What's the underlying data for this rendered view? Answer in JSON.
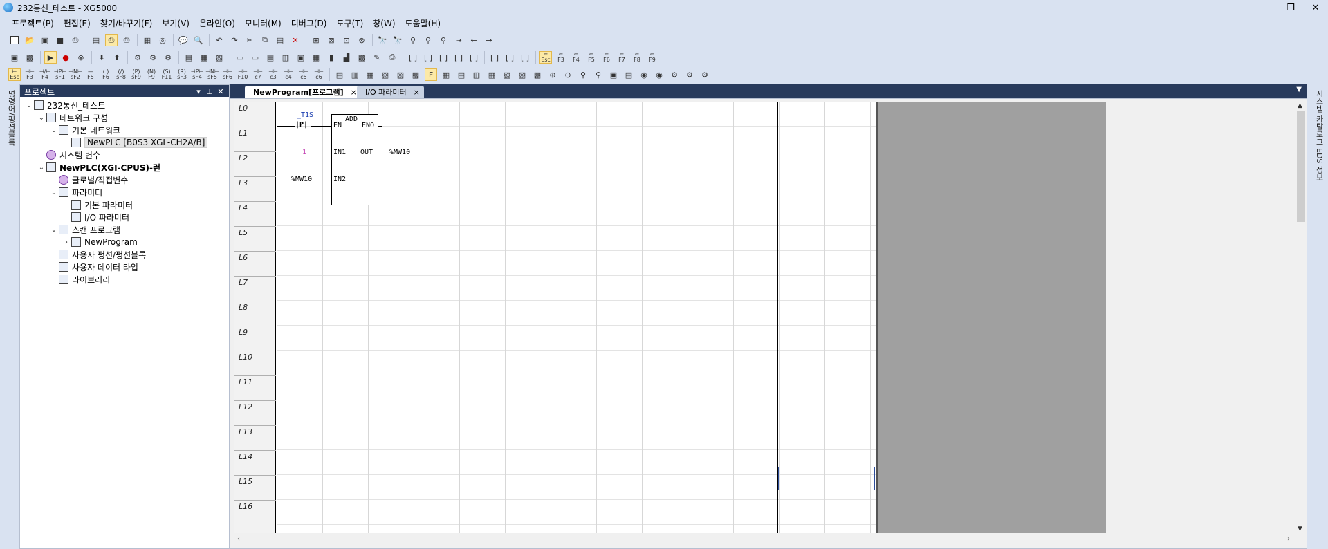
{
  "window": {
    "title": "232통신_테스트 - XG5000",
    "minimize": "–",
    "restore": "❐",
    "close": "✕"
  },
  "menu": [
    "프로젝트(P)",
    "편집(E)",
    "찾기/바꾸기(F)",
    "보기(V)",
    "온라인(O)",
    "모니터(M)",
    "디버그(D)",
    "도구(T)",
    "창(W)",
    "도움말(H)"
  ],
  "toolbar3_labels": [
    "Esc",
    "F3",
    "F4",
    "sF1",
    "sF2",
    "F5",
    "F6",
    "sF8",
    "sF9",
    "F9",
    "F11",
    "sF3",
    "sF4",
    "sF5",
    "sF6",
    "F10",
    "c7",
    "c3",
    "c4",
    "c5",
    "c6"
  ],
  "toolbar2_fkeys": [
    "Esc",
    "F3",
    "F4",
    "F5",
    "F6",
    "F7",
    "F8",
    "F9"
  ],
  "left_strip": {
    "label": "명령어/펑션블록"
  },
  "right_strip": {
    "label": "시스템 카탈로그  EDS 정보"
  },
  "project_panel": {
    "title": "프로젝트",
    "tree": [
      {
        "label": "232통신_테스트",
        "level": 0,
        "toggle": "v"
      },
      {
        "label": "네트워크 구성",
        "level": 1,
        "toggle": "v"
      },
      {
        "label": "기본 네트워크",
        "level": 2,
        "toggle": "v"
      },
      {
        "label": "NewPLC [B0S3 XGL-CH2A/B]",
        "level": 3,
        "toggle": "",
        "selected": true
      },
      {
        "label": "시스템 변수",
        "level": 1,
        "toggle": ""
      },
      {
        "label": "NewPLC(XGI-CPUS)-런",
        "level": 1,
        "toggle": "v",
        "bold": true
      },
      {
        "label": "글로벌/직접변수",
        "level": 2,
        "toggle": ""
      },
      {
        "label": "파라미터",
        "level": 2,
        "toggle": "v"
      },
      {
        "label": "기본 파라미터",
        "level": 3,
        "toggle": ""
      },
      {
        "label": "I/O 파라미터",
        "level": 3,
        "toggle": ""
      },
      {
        "label": "스캔 프로그램",
        "level": 2,
        "toggle": "v"
      },
      {
        "label": "NewProgram",
        "level": 3,
        "toggle": ">"
      },
      {
        "label": "사용자 펑션/펑션블록",
        "level": 2,
        "toggle": ""
      },
      {
        "label": "사용자 데이터 타입",
        "level": 2,
        "toggle": ""
      },
      {
        "label": "라이브러리",
        "level": 2,
        "toggle": ""
      }
    ]
  },
  "tabs": [
    {
      "label": "NewProgram[프로그램]",
      "active": true,
      "close": "×"
    },
    {
      "label": "I/O 파라미터",
      "active": false,
      "close": "×"
    }
  ],
  "ladder": {
    "rows": [
      "L0",
      "L1",
      "L2",
      "L3",
      "L4",
      "L5",
      "L6",
      "L7",
      "L8",
      "L9",
      "L10",
      "L11",
      "L12",
      "L13",
      "L14",
      "L15",
      "L16"
    ],
    "contact_label": "_T1S",
    "contact_symbol": "|P|",
    "fb_name": "ADD",
    "fb_en": "EN",
    "fb_eno": "ENO",
    "fb_in1": "IN1",
    "fb_in2": "IN2",
    "fb_out": "OUT",
    "in1_value": "1",
    "in2_value": "%MW10",
    "out_value": "%MW10"
  }
}
